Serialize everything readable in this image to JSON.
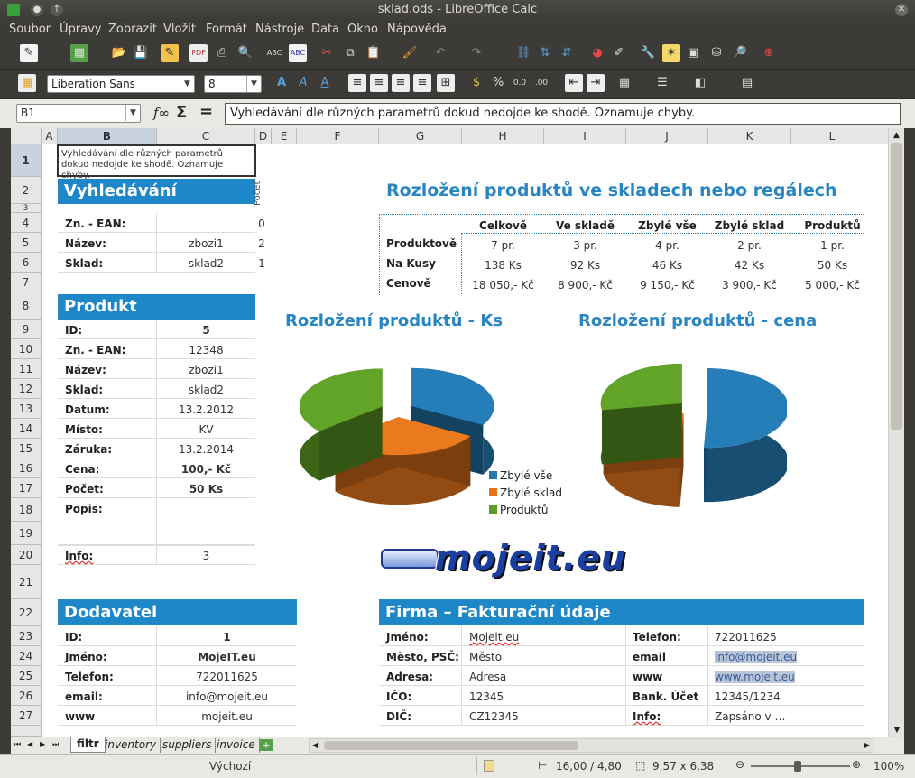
{
  "window": {
    "title": "sklad.ods - LibreOffice Calc"
  },
  "menu": [
    "Soubor",
    "Úpravy",
    "Zobrazit",
    "Vložit",
    "Formát",
    "Nástroje",
    "Data",
    "Okno",
    "Nápověda"
  ],
  "font": {
    "name": "Liberation Sans",
    "size": "8"
  },
  "formula": {
    "cell_ref": "B1",
    "content": "Vyhledávání dle různých parametrů dokud nedojde ke shodě. Oznamuje chyby."
  },
  "columns": [
    "A",
    "B",
    "C",
    "D",
    "E",
    "F",
    "G",
    "H",
    "I",
    "J",
    "K",
    "L"
  ],
  "rows": [
    "1",
    "2",
    "3",
    "4",
    "5",
    "6",
    "7",
    "8",
    "9",
    "10",
    "11",
    "12",
    "13",
    "14",
    "15",
    "16",
    "17",
    "18",
    "19",
    "20",
    "21",
    "22",
    "23",
    "24",
    "25",
    "26",
    "27"
  ],
  "note": "Vyhledávání dle různých parametrů dokud nedojde ke shodě. Oznamuje chyby.",
  "search": {
    "title": "Vyhledávání",
    "pocet_label": "Počet",
    "rows": [
      {
        "label": "Zn. - EAN:",
        "value": "",
        "count": "0"
      },
      {
        "label": "Název:",
        "value": "zbozi1",
        "count": "2"
      },
      {
        "label": "Sklad:",
        "value": "sklad2",
        "count": "1"
      }
    ]
  },
  "product": {
    "title": "Produkt",
    "rows": [
      {
        "label": "ID:",
        "value": "5"
      },
      {
        "label": "Zn. - EAN:",
        "value": "12348"
      },
      {
        "label": "Název:",
        "value": "zbozi1"
      },
      {
        "label": "Sklad:",
        "value": "sklad2"
      },
      {
        "label": "Datum:",
        "value": "13.2.2012"
      },
      {
        "label": "Místo:",
        "value": "KV"
      },
      {
        "label": "Záruka:",
        "value": "13.2.2014"
      },
      {
        "label": "Cena:",
        "value": "100,- Kč"
      },
      {
        "label": "Počet:",
        "value": "50 Ks"
      },
      {
        "label": "Popis:",
        "value": ""
      }
    ],
    "info_label": "Info:",
    "info_value": "3"
  },
  "distribution": {
    "title": "Rozložení produktů ve skladech nebo regálech",
    "headers": [
      "Celkově",
      "Ve skladě",
      "Zbylé vše",
      "Zbylé sklad",
      "Produktů"
    ],
    "rows": [
      {
        "label": "Produktově",
        "values": [
          "7 pr.",
          "3 pr.",
          "4 pr.",
          "2 pr.",
          "1 pr."
        ]
      },
      {
        "label": "Na Kusy",
        "values": [
          "138 Ks",
          "92 Ks",
          "46 Ks",
          "42 Ks",
          "50 Ks"
        ]
      },
      {
        "label": "Cenově",
        "values": [
          "18 050,- Kč",
          "8 900,- Kč",
          "9 150,- Kč",
          "3 900,- Kč",
          "5 000,- Kč"
        ]
      }
    ]
  },
  "chart_data": [
    {
      "type": "pie",
      "title": "Rozložení produktů - Ks",
      "categories": [
        "Zbylé vše",
        "Zbylé sklad",
        "Produktů"
      ],
      "values": [
        46,
        42,
        50
      ],
      "colors": [
        "#2478b0",
        "#e0731c",
        "#5d9c25"
      ],
      "legend": "bottom-right"
    },
    {
      "type": "pie",
      "title": "Rozložení produktů - cena",
      "categories": [
        "Zbylé vše",
        "Zbylé sklad",
        "Produktů"
      ],
      "values": [
        9150,
        3900,
        5000
      ],
      "colors": [
        "#2478b0",
        "#e0731c",
        "#5d9c25"
      ]
    }
  ],
  "logo": {
    "text": "mojeit.eu"
  },
  "supplier": {
    "title": "Dodavatel",
    "rows": [
      {
        "label": "ID:",
        "value": "1",
        "bold": true
      },
      {
        "label": "Jméno:",
        "value": "MojeIT.eu",
        "bold": true
      },
      {
        "label": "Telefon:",
        "value": "722011625",
        "bold": false
      },
      {
        "label": "email:",
        "value": "info@mojeit.eu",
        "bold": false
      },
      {
        "label": "www",
        "value": "mojeit.eu",
        "bold": false
      }
    ]
  },
  "company": {
    "title": "Firma – Fakturační údaje",
    "left": [
      {
        "label": "Jméno:",
        "value": "Mojeit.eu"
      },
      {
        "label": "Město, PSČ:",
        "value": "Město"
      },
      {
        "label": "Adresa:",
        "value": "Adresa"
      },
      {
        "label": "IČO:",
        "value": "12345"
      },
      {
        "label": "DIČ:",
        "value": "CZ12345"
      }
    ],
    "right": [
      {
        "label": "Telefon:",
        "value": "722011625"
      },
      {
        "label": "email",
        "value": "info@mojeit.eu"
      },
      {
        "label": "www",
        "value": "www.mojeit.eu"
      },
      {
        "label": "Bank. Účet",
        "value": "12345/1234"
      },
      {
        "label": "Info:",
        "value": "Zapsáno v …"
      }
    ]
  },
  "tabs": [
    "filtr",
    "inventory",
    "suppliers",
    "invoice"
  ],
  "status": {
    "style": "Výchozí",
    "position": "16,00 / 4,80",
    "size": "9,57 x 6,38",
    "zoom": "100%"
  }
}
